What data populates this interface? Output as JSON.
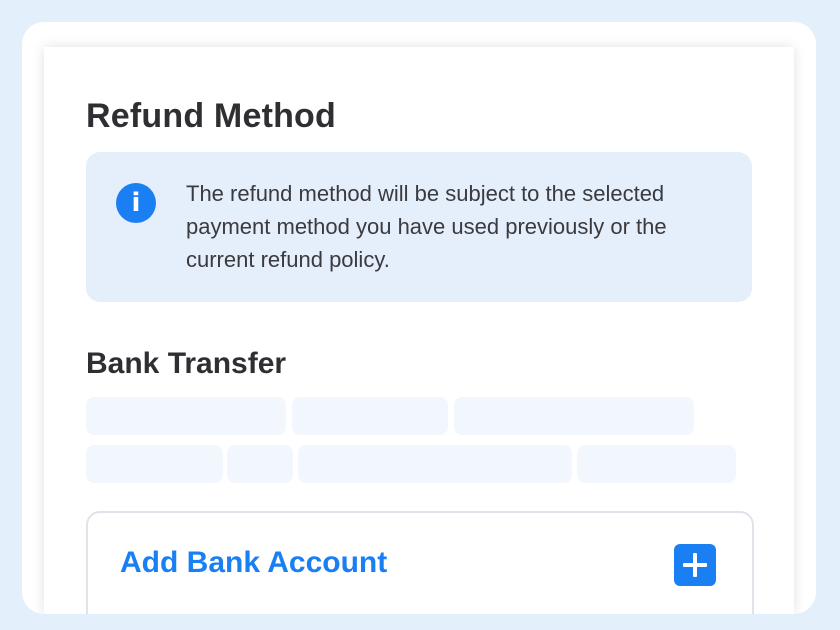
{
  "page": {
    "title": "Refund Method"
  },
  "info_box": {
    "icon": "info-icon",
    "icon_glyph": "i",
    "text": "The refund method will be subject to the selected payment method you have used previously or the current refund policy."
  },
  "bank_transfer": {
    "title": "Bank Transfer",
    "loading_placeholders": true
  },
  "add_bank_account": {
    "label": "Add Bank Account",
    "icon": "plus-icon"
  },
  "colors": {
    "accent": "#1a7ff3",
    "info_background": "#e5effc",
    "page_background": "#e4effc",
    "text": "#2f2f33"
  }
}
